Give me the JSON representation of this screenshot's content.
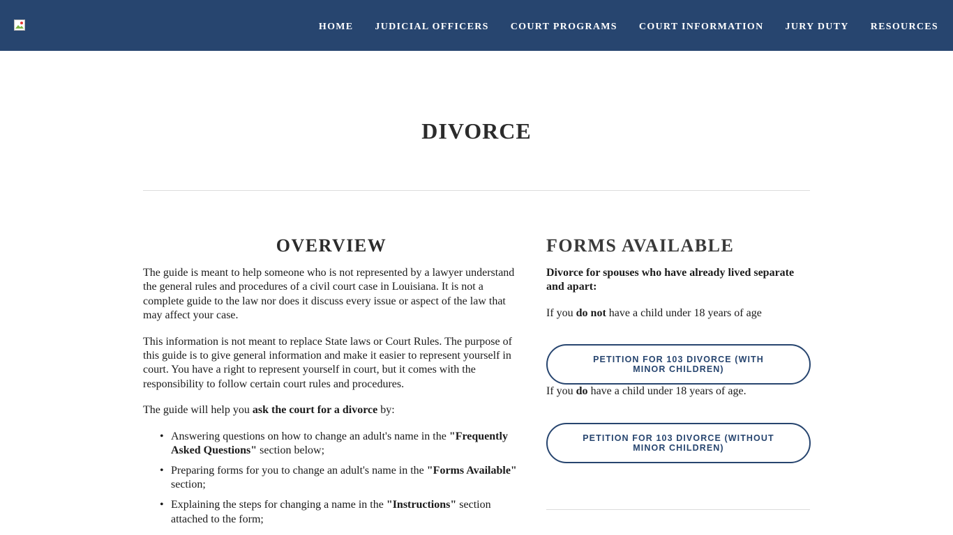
{
  "nav": {
    "items": [
      "HOME",
      "JUDICIAL OFFICERS",
      "COURT PROGRAMS",
      "COURT INFORMATION",
      "JURY DUTY",
      "RESOURCES"
    ]
  },
  "page": {
    "title": "DIVORCE"
  },
  "overview": {
    "heading": "OVERVIEW",
    "p1": "The guide is meant to help someone who is not represented by a lawyer understand the general rules and procedures of a civil court case in Louisiana. It is not a complete guide to the law nor does it discuss every issue or aspect of the law that may affect your case.",
    "p2": " This information is not meant to replace State laws or Court Rules. The purpose of this guide is to give general information and make it easier to represent yourself in court.  You have a right to represent yourself in court, but it comes with the responsibility to follow certain court rules and procedures.",
    "p3_before": "The guide will help you ",
    "p3_bold": "ask the court for a divorce",
    "p3_after": " by:",
    "bullets": [
      {
        "before": "Answering questions on how to change an adult's name in the ",
        "bold": "\"Frequently Asked Questions\"",
        "after": " section below;"
      },
      {
        "before": "Preparing forms for you to change an adult's name in the ",
        "bold": "\"Forms Available\"",
        "after": " section;"
      },
      {
        "before": "Explaining the steps for changing a name in the ",
        "bold": "\"Instructions\"",
        "after": " section attached to the form;"
      }
    ]
  },
  "forms": {
    "heading": "FORMS AVAILABLE",
    "subheading": "Divorce for spouses who have already lived separate and apart:",
    "cond1_before": "If you ",
    "cond1_bold": "do not",
    "cond1_after": " have a child under 18 years of age",
    "button1": "PETITION FOR 103 DIVORCE (WITH MINOR CHILDREN)",
    "cond2_before": "If you ",
    "cond2_bold": "do",
    "cond2_after": " have a child under 18 years of age.",
    "button2": "PETITION FOR 103 DIVORCE (WITHOUT MINOR CHILDREN)"
  }
}
